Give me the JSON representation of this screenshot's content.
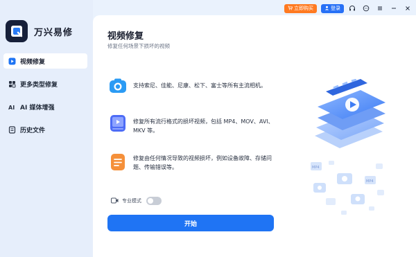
{
  "app": {
    "name": "万兴易修"
  },
  "sidebar": {
    "items": [
      {
        "label": "视频修复",
        "icon": "play-circle-icon",
        "active": true
      },
      {
        "label": "更多类型修复",
        "icon": "puzzle-icon",
        "active": false
      },
      {
        "label": "AI 媒体增强",
        "icon": "ai-icon",
        "active": false
      },
      {
        "label": "历史文件",
        "icon": "history-file-icon",
        "active": false
      }
    ]
  },
  "topbar": {
    "buy_label": "立即购买",
    "login_label": "登录",
    "icons": [
      "headset-icon",
      "chat-icon",
      "menu-icon",
      "minimize-icon",
      "close-icon"
    ]
  },
  "main": {
    "title": "视频修复",
    "subtitle": "修复任何场景下损坏的视频",
    "features": [
      {
        "icon": "camera-icon",
        "text": "支持索尼、佳能、尼康、松下、富士等所有主流相机。"
      },
      {
        "icon": "video-file-icon",
        "text": "修复所有流行格式的损坏视频，包括 MP4、MOV、AVI、MKV 等。"
      },
      {
        "icon": "document-icon",
        "text": "修复由任何情况导致的视频损坏，例如设备故障、存储问题、传输错误等。"
      }
    ],
    "pro_mode_label": "专业模式",
    "pro_mode_on": false,
    "start_label": "开始"
  },
  "colors": {
    "accent": "#1f74f4",
    "buy": "#ff7a21",
    "sidebar_bg": "#e6eefb",
    "dark_logo": "#17203a"
  }
}
